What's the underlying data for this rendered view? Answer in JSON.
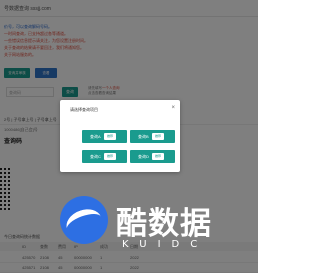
{
  "header": {
    "site_title": "号数据查询 sssjj.com"
  },
  "notices": [
    {
      "text": "价号，可以查询解码号码。",
      "color": "blue"
    },
    {
      "text": "一时间查询，已支持超过各等通道。",
      "color": "red"
    },
    {
      "text": "一些错误信息提示请关注，为您设置注册时间。",
      "color": "red"
    },
    {
      "text": "关于查询的结果请不要回注，我们将通知您。",
      "color": "red"
    },
    {
      "text": "关于网站服务的。",
      "color": "red"
    }
  ],
  "actions": {
    "green_label": "查询并审核",
    "blue_label": "查看"
  },
  "query": {
    "placeholder": "查询码",
    "button": "查询",
    "note_line1": "请先填写",
    "note_highlight": "一个人查询",
    "note_line2": "点击查看查询结果"
  },
  "section": {
    "tabs": "2号 | 子号拿上号 | 子号拿上号",
    "date": "1000486[自己会]号",
    "title": "查询码"
  },
  "qr_label": "今日查询码统计数据",
  "table": {
    "headers": [
      "ID",
      "查数",
      "费用",
      "IP",
      "成功",
      "日期"
    ],
    "rows": [
      [
        "425570",
        "2108",
        "45",
        "00000000",
        "1",
        "2022"
      ],
      [
        "425571",
        "2108",
        "45",
        "00000000",
        "1",
        "2022"
      ]
    ]
  },
  "modal": {
    "title": "请选择查询项目",
    "close": "×",
    "options": [
      {
        "label": "查询A",
        "badge": "推荐"
      },
      {
        "label": "查询B",
        "badge": "推荐"
      },
      {
        "label": "查询C",
        "badge": "推荐"
      },
      {
        "label": "查询D",
        "badge": "推荐"
      }
    ]
  },
  "watermark": {
    "main": "酷数据",
    "sub": "KUIDC"
  },
  "colors": {
    "teal": "#1a9b8e",
    "blue": "#2f74c8",
    "red": "#e04b3b",
    "logo_blue": "#2d6fe3"
  }
}
